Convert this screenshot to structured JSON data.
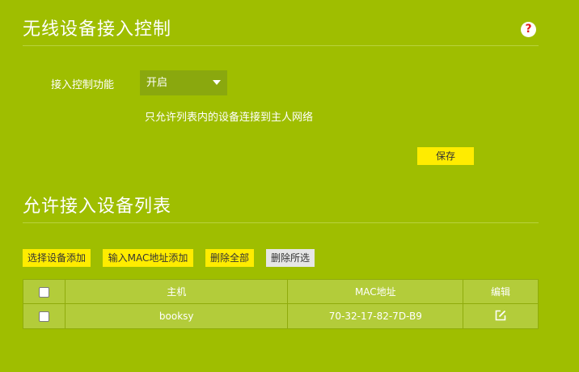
{
  "section1": {
    "title": "无线设备接入控制",
    "help_symbol": "?",
    "field_label": "接入控制功能",
    "select_value": "开启",
    "hint": "只允许列表内的设备连接到主人网络",
    "save_label": "保存"
  },
  "section2": {
    "title": "允许接入设备列表",
    "buttons": {
      "select_add": "选择设备添加",
      "mac_add": "输入MAC地址添加",
      "delete_all": "删除全部",
      "delete_selected": "删除所选"
    },
    "table": {
      "headers": {
        "host": "主机",
        "mac": "MAC地址",
        "edit": "编辑"
      },
      "rows": [
        {
          "host": "booksy",
          "mac": "70-32-17-82-7D-B9"
        }
      ]
    }
  },
  "colors": {
    "background": "#9fbe00",
    "primary_button": "#ffec00",
    "secondary_button": "#e6e6e6",
    "help_icon": "#e02020"
  },
  "icons": [
    "help-icon",
    "dropdown-caret-icon",
    "edit-icon"
  ]
}
